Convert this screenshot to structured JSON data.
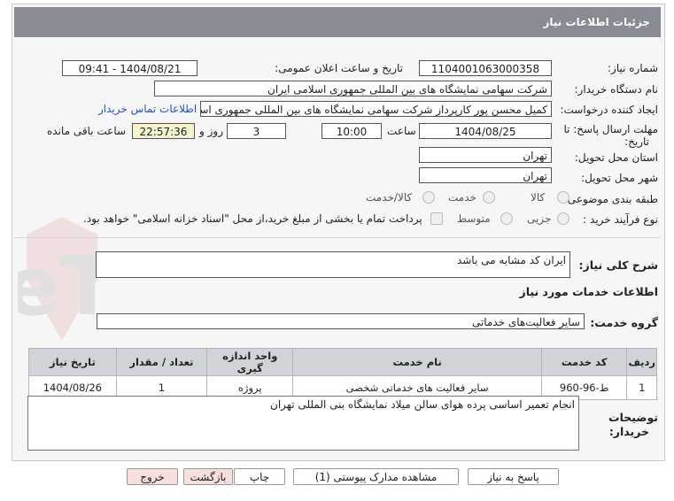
{
  "title": "جزئیات اطلاعات نیاز",
  "fields": {
    "need_number_label": "شماره نیاز:",
    "need_number": "1104001063000358",
    "announce_label": "تاریخ و ساعت اعلان عمومی:",
    "announce_value": "1404/08/21 - 09:41",
    "buyer_org_label": "نام دستگاه خریدار:",
    "buyer_org": "شرکت سهامی نمایشگاه های بین المللی جمهوری اسلامی ایران",
    "creator_label": "ایجاد کننده درخواست:",
    "creator": "کمیل محسن پور کارپرداز شرکت سهامی نمایشگاه های بین المللی جمهوری اسلامی ایران",
    "contact_link": "اطلاعات تماس خریدار",
    "deadline_label_1": "مهلت ارسال پاسخ: تا",
    "deadline_label_2": "تاریخ:",
    "deadline_date": "1404/08/25",
    "time_label": "ساعت",
    "deadline_time": "10:00",
    "days": "3",
    "days_label": "روز و",
    "remaining": "22:57:36",
    "remaining_label": "ساعت باقی مانده",
    "province_label": "استان محل تحویل:",
    "province": "تهران",
    "city_label": "شهر محل تحویل:",
    "city": "تهران",
    "category_label": "طبقه بندی موضوعی:",
    "cat_goods": "کالا",
    "cat_service": "خدمت",
    "cat_both": "کالا/خدمت",
    "purchase_type_label": "نوع فرآیند خرید :",
    "pt_partial": "جزیی",
    "pt_medium": "متوسط",
    "pt_note": "پرداخت تمام یا بخشی از مبلغ خرید،از محل \"اسناد خزانه اسلامی\" خواهد بود."
  },
  "summary": {
    "label": "شرح کلی نیاز:",
    "value": "ایران کد مشابه می باشد"
  },
  "services_heading": "اطلاعات خدمات مورد نیاز",
  "service_group": {
    "label": "گروه خدمت:",
    "value": "سایر فعالیت‌های خدماتی"
  },
  "table": {
    "headers": [
      "ردیف",
      "کد خدمت",
      "نام خدمت",
      "واحد اندازه گیری",
      "تعداد / مقدار",
      "تاریخ نیاز"
    ],
    "rows": [
      [
        "1",
        "ط-96-960",
        "سایر فعالیت های خدماتی شخصی",
        "پروژه",
        "1",
        "1404/08/26"
      ]
    ]
  },
  "buyer_notes": {
    "label_1": "توضیحات",
    "label_2": "خریدار:",
    "value": "انجام تعمیر اساسی پرده هوای سالن میلاد نمایشگاه بنی المللی تهران"
  },
  "buttons": {
    "reply": "پاسخ به نیاز",
    "attachments": "مشاهده مدارک پیوستی (1)",
    "print": "چاپ",
    "back": "بازگشت",
    "exit": "خروج"
  },
  "watermark": "AriaTender.neT",
  "colors": {
    "title_bg": "#888b91",
    "link": "#2255cc",
    "highlight": "#f7f3cf",
    "pink_button": "#f9dede"
  }
}
